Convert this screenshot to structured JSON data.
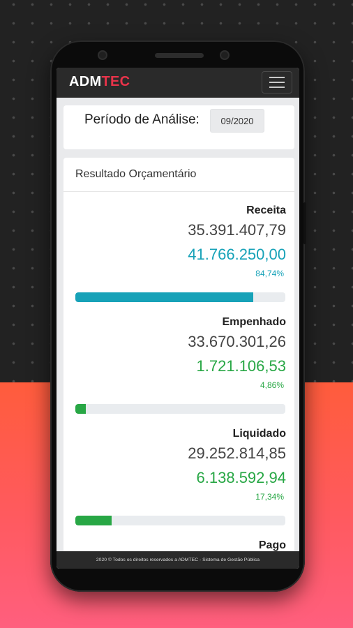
{
  "app": {
    "brand_part1": "ADM",
    "brand_part2": "TEC"
  },
  "period": {
    "label": "Período de Análise:",
    "value": "09/2020"
  },
  "results": {
    "title": "Resultado Orçamentário",
    "metrics": [
      {
        "label": "Receita",
        "primary": "35.391.407,79",
        "secondary": "41.766.250,00",
        "percent": "84,74%",
        "progress": 0.8474,
        "color": "#17a2b8"
      },
      {
        "label": "Empenhado",
        "primary": "33.670.301,26",
        "secondary": "1.721.106,53",
        "percent": "4,86%",
        "progress": 0.0486,
        "color": "#28a745"
      },
      {
        "label": "Liquidado",
        "primary": "29.252.814,85",
        "secondary": "6.138.592,94",
        "percent": "17,34%",
        "progress": 0.1734,
        "color": "#28a745"
      },
      {
        "label": "Pago"
      }
    ]
  },
  "footer": {
    "text": "2020 © Todos os direitos reservados a ADMTEC - Sistema de Gestão Pública"
  },
  "colors": {
    "brand_accent": "#e8334a",
    "info": "#17a2b8",
    "success": "#28a745"
  }
}
